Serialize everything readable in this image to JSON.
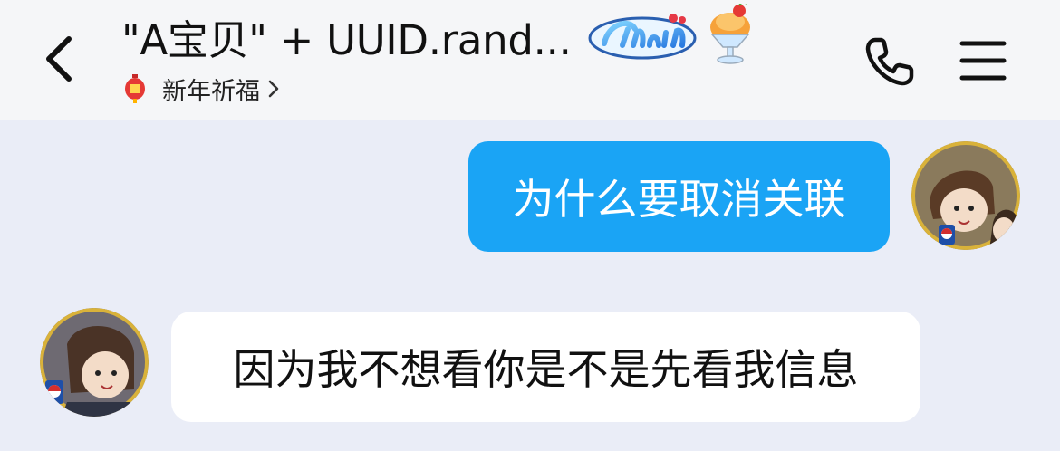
{
  "header": {
    "title": "\"A宝贝\" + UUID.rand...",
    "badge_icon": "chum-badge-icon",
    "decor_icon": "ice-cream-sundae-icon",
    "subtitle": {
      "icon": "red-lantern-icon",
      "label": "新年祈福"
    },
    "actions": [
      "phone-icon",
      "menu-icon"
    ]
  },
  "messages": [
    {
      "side": "outgoing",
      "text": "为什么要取消关联",
      "bubble_color": "#1aa4f5"
    },
    {
      "side": "incoming",
      "text": "因为我不想看你是不是先看我信息",
      "bubble_color": "#ffffff"
    }
  ],
  "colors": {
    "background": "#eaedf7",
    "header": "#f5f6f8",
    "accent": "#1aa4f5"
  }
}
